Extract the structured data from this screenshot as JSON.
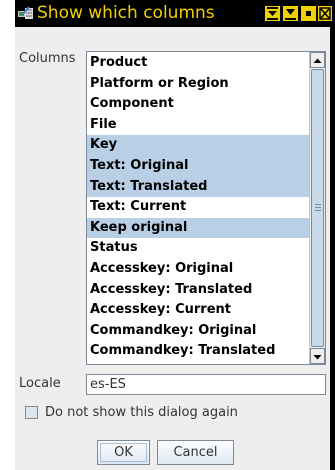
{
  "window": {
    "title": "Show which columns",
    "title_color": "#f0d000",
    "titlebar_color": "#000000",
    "icons": [
      "app-icon",
      "shade-icon",
      "maximize-icon",
      "minimize-icon",
      "close-icon"
    ]
  },
  "dialog": {
    "columns_label": "Columns",
    "columns": [
      {
        "label": "Product",
        "selected": false
      },
      {
        "label": "Platform or Region",
        "selected": false
      },
      {
        "label": "Component",
        "selected": false
      },
      {
        "label": "File",
        "selected": false
      },
      {
        "label": "Key",
        "selected": true
      },
      {
        "label": "Text: Original",
        "selected": true
      },
      {
        "label": "Text: Translated",
        "selected": true
      },
      {
        "label": "Text: Current",
        "selected": false
      },
      {
        "label": "Keep original",
        "selected": true
      },
      {
        "label": "Status",
        "selected": false
      },
      {
        "label": "Accesskey: Original",
        "selected": false
      },
      {
        "label": "Accesskey: Translated",
        "selected": false
      },
      {
        "label": "Accesskey: Current",
        "selected": false
      },
      {
        "label": "Commandkey: Original",
        "selected": false
      },
      {
        "label": "Commandkey: Translated",
        "selected": false
      }
    ],
    "selection_color": "#b8cfe5",
    "locale_label": "Locale",
    "locale_value": "es-ES",
    "dont_show_label": "Do not show this dialog again",
    "dont_show_checked": false,
    "ok_label": "OK",
    "cancel_label": "Cancel"
  }
}
